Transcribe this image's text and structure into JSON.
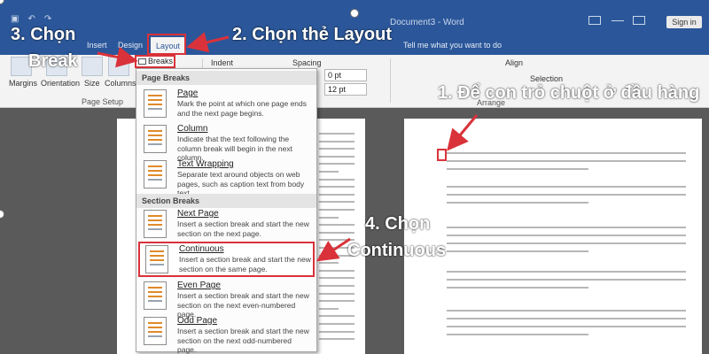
{
  "window": {
    "title": "Document3 - Word",
    "sign_in": "Sign in"
  },
  "tabs": {
    "insert": "Insert",
    "design": "Design",
    "layout": "Layout",
    "tell_me": "Tell me what you want to do"
  },
  "ribbon": {
    "margins": "Margins",
    "orientation": "Orientation",
    "size": "Size",
    "columns": "Columns",
    "page_setup": "Page Setup",
    "breaks": "Breaks",
    "indent": "Indent",
    "spacing": "Spacing",
    "spacing_before": "0 pt",
    "spacing_after": "12 pt",
    "align": "Align",
    "selection": "Selection",
    "arrange": "Arrange"
  },
  "breaks_menu": {
    "page_breaks_header": "Page Breaks",
    "section_breaks_header": "Section Breaks",
    "items": [
      {
        "title": "Page",
        "desc": "Mark the point at which one page ends and the next page begins."
      },
      {
        "title": "Column",
        "desc": "Indicate that the text following the column break will begin in the next column."
      },
      {
        "title": "Text Wrapping",
        "desc": "Separate text around objects on web pages, such as caption text from body text."
      },
      {
        "title": "Next Page",
        "desc": "Insert a section break and start the new section on the next page."
      },
      {
        "title": "Continuous",
        "desc": "Insert a section break and start the new section on the same page."
      },
      {
        "title": "Even Page",
        "desc": "Insert a section break and start the new section on the next even-numbered page."
      },
      {
        "title": "Odd Page",
        "desc": "Insert a section break and start the new section on the next odd-numbered page."
      }
    ]
  },
  "annotations": {
    "step1": "1. Để con trỏ chuột ở đầu hàng",
    "step2": "2. Chọn thẻ Layout",
    "step3_line1": "3. Chọn",
    "step3_line2": "Break",
    "step4_line1": "4. Chọn",
    "step4_line2": "Continuous"
  },
  "colors": {
    "accent_red": "#d9323a",
    "word_blue": "#2b579a"
  }
}
